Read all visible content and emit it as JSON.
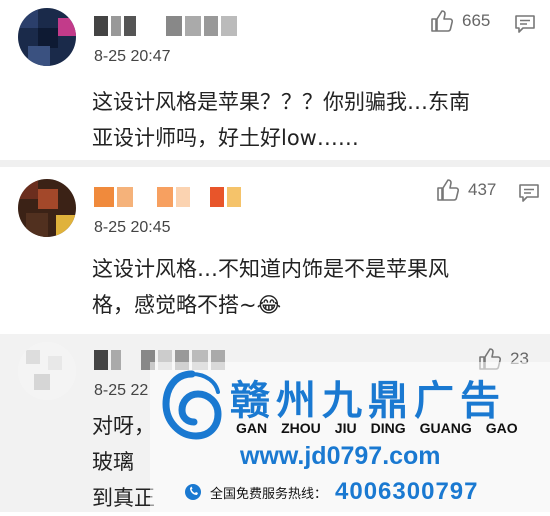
{
  "comments": [
    {
      "date": "8-25 20:47",
      "likes": "665",
      "text_line1": "这设计风格是苹果？？？你别骗我…东南",
      "text_line2": "亚设计师吗，好土好low……"
    },
    {
      "date": "8-25 20:45",
      "likes": "437",
      "text_line1": "这设计风格…不知道内饰是不是苹果风",
      "text_line2": "格，感觉略不搭~😂"
    },
    {
      "date": "8-25 22",
      "likes": "23",
      "text_line1": "对呀，",
      "text_line2": "玻璃",
      "text_line3": "到真正"
    }
  ],
  "watermark": {
    "title": "赣州九鼎广告",
    "pinyin": [
      "GAN",
      "ZHOU",
      "JIU",
      "DING",
      "GUANG",
      "GAO"
    ],
    "url": "www.jd0797.com",
    "hotline_label": "全国免费服务热线：",
    "hotline_number": "4006300797",
    "brand_color": "#1a79d1"
  },
  "icons": [
    "thumbs-up-icon",
    "reply-comment-icon",
    "phone-icon"
  ]
}
